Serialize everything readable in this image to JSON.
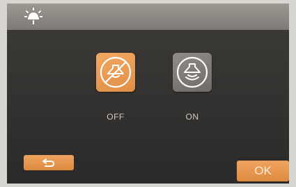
{
  "header": {
    "icon": "light-sun-icon"
  },
  "modes": [
    {
      "label": "OFF",
      "icon": "lamp-crossed-icon",
      "selected": true,
      "color": "#e9994f"
    },
    {
      "label": "ON",
      "icon": "lamp-on-icon",
      "selected": false,
      "color": "#807d79"
    }
  ],
  "footer": {
    "back_icon": "back-arrow-icon",
    "ok_label": "OK"
  },
  "colors": {
    "accent": "#e9994f",
    "screen_bg": "#363432",
    "header_bg": "#8a8782",
    "text": "#cfcac3"
  }
}
